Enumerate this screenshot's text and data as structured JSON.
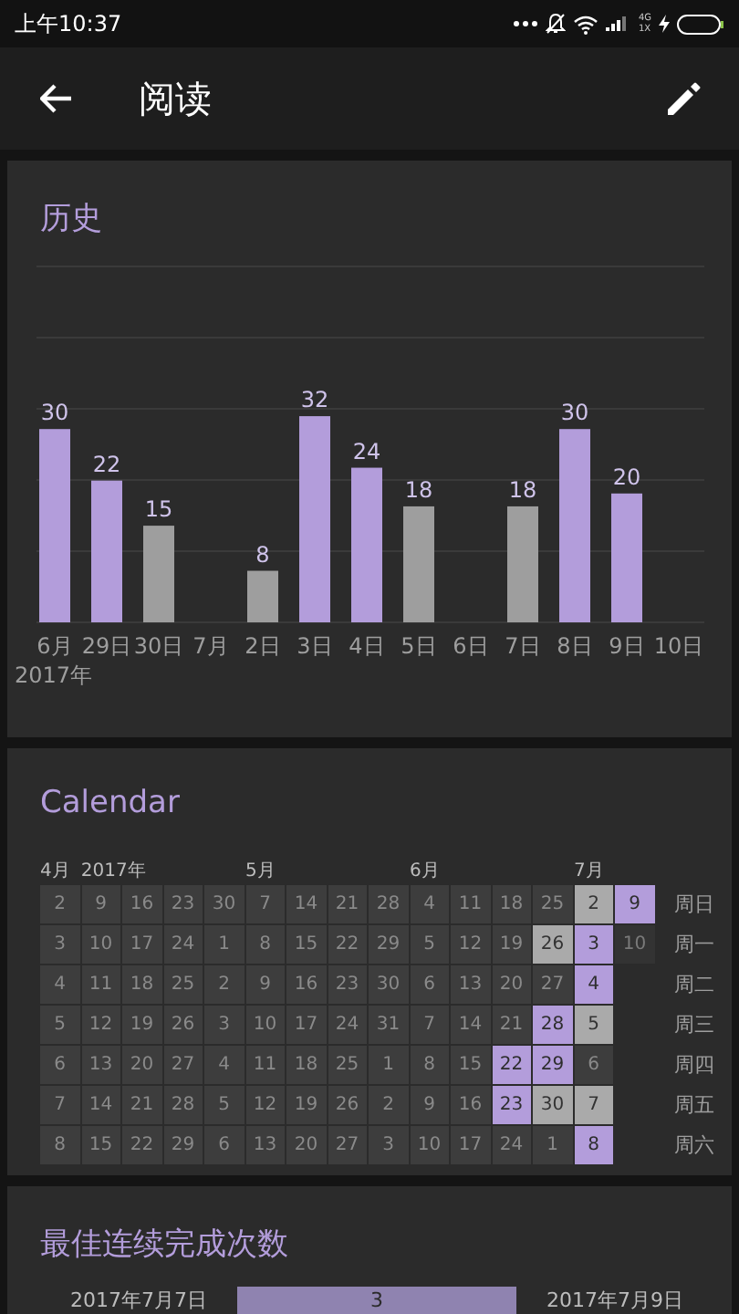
{
  "status_bar": {
    "time": "上午10:37",
    "network_top": "4G",
    "network_bottom": "1X"
  },
  "app_bar": {
    "title": "阅读"
  },
  "history": {
    "title": "历史",
    "year_label": "2017年",
    "chart_data": {
      "type": "bar",
      "stacked": true,
      "data_labels": true,
      "categories": [
        "6月",
        "29日",
        "30日",
        "7月",
        "2日",
        "3日",
        "4日",
        "5日",
        "6日",
        "7日",
        "8日",
        "9日",
        "10日"
      ],
      "series": [
        {
          "color": "#b39ddb",
          "values": [
            30,
            22,
            null,
            null,
            null,
            32,
            24,
            null,
            null,
            null,
            30,
            20,
            null
          ]
        },
        {
          "color": "#9e9e9e",
          "values": [
            null,
            null,
            15,
            null,
            8,
            null,
            null,
            18,
            null,
            18,
            null,
            null,
            null
          ]
        }
      ]
    }
  },
  "calendar": {
    "title": "Calendar",
    "weekdays": [
      "周日",
      "周一",
      "周二",
      "周三",
      "周四",
      "周五",
      "周六"
    ],
    "columns": [
      {
        "month_label": "4月",
        "year_label": "2017年",
        "days": [
          {
            "day": "2",
            "kind": "none"
          },
          {
            "day": "3",
            "kind": "none"
          },
          {
            "day": "4",
            "kind": "none"
          },
          {
            "day": "5",
            "kind": "none"
          },
          {
            "day": "6",
            "kind": "none"
          },
          {
            "day": "7",
            "kind": "none"
          },
          {
            "day": "8",
            "kind": "none"
          }
        ]
      },
      {
        "days": [
          {
            "day": "9",
            "kind": "none"
          },
          {
            "day": "10",
            "kind": "none"
          },
          {
            "day": "11",
            "kind": "none"
          },
          {
            "day": "12",
            "kind": "none"
          },
          {
            "day": "13",
            "kind": "none"
          },
          {
            "day": "14",
            "kind": "none"
          },
          {
            "day": "15",
            "kind": "none"
          }
        ]
      },
      {
        "days": [
          {
            "day": "16",
            "kind": "none"
          },
          {
            "day": "17",
            "kind": "none"
          },
          {
            "day": "18",
            "kind": "none"
          },
          {
            "day": "19",
            "kind": "none"
          },
          {
            "day": "20",
            "kind": "none"
          },
          {
            "day": "21",
            "kind": "none"
          },
          {
            "day": "22",
            "kind": "none"
          }
        ]
      },
      {
        "days": [
          {
            "day": "23",
            "kind": "none"
          },
          {
            "day": "24",
            "kind": "none"
          },
          {
            "day": "25",
            "kind": "none"
          },
          {
            "day": "26",
            "kind": "none"
          },
          {
            "day": "27",
            "kind": "none"
          },
          {
            "day": "28",
            "kind": "none"
          },
          {
            "day": "29",
            "kind": "none"
          }
        ]
      },
      {
        "days": [
          {
            "day": "30",
            "kind": "none"
          },
          {
            "day": "1",
            "kind": "none"
          },
          {
            "day": "2",
            "kind": "none"
          },
          {
            "day": "3",
            "kind": "none"
          },
          {
            "day": "4",
            "kind": "none"
          },
          {
            "day": "5",
            "kind": "none"
          },
          {
            "day": "6",
            "kind": "none"
          }
        ]
      },
      {
        "month_label": "5月",
        "days": [
          {
            "day": "7",
            "kind": "none"
          },
          {
            "day": "8",
            "kind": "none"
          },
          {
            "day": "9",
            "kind": "none"
          },
          {
            "day": "10",
            "kind": "none"
          },
          {
            "day": "11",
            "kind": "none"
          },
          {
            "day": "12",
            "kind": "none"
          },
          {
            "day": "13",
            "kind": "none"
          }
        ]
      },
      {
        "days": [
          {
            "day": "14",
            "kind": "none"
          },
          {
            "day": "15",
            "kind": "none"
          },
          {
            "day": "16",
            "kind": "none"
          },
          {
            "day": "17",
            "kind": "none"
          },
          {
            "day": "18",
            "kind": "none"
          },
          {
            "day": "19",
            "kind": "none"
          },
          {
            "day": "20",
            "kind": "none"
          }
        ]
      },
      {
        "days": [
          {
            "day": "21",
            "kind": "none"
          },
          {
            "day": "22",
            "kind": "none"
          },
          {
            "day": "23",
            "kind": "none"
          },
          {
            "day": "24",
            "kind": "none"
          },
          {
            "day": "25",
            "kind": "none"
          },
          {
            "day": "26",
            "kind": "none"
          },
          {
            "day": "27",
            "kind": "none"
          }
        ]
      },
      {
        "days": [
          {
            "day": "28",
            "kind": "none"
          },
          {
            "day": "29",
            "kind": "none"
          },
          {
            "day": "30",
            "kind": "none"
          },
          {
            "day": "31",
            "kind": "none"
          },
          {
            "day": "1",
            "kind": "none"
          },
          {
            "day": "2",
            "kind": "none"
          },
          {
            "day": "3",
            "kind": "none"
          }
        ]
      },
      {
        "month_label": "6月",
        "days": [
          {
            "day": "4",
            "kind": "none"
          },
          {
            "day": "5",
            "kind": "none"
          },
          {
            "day": "6",
            "kind": "none"
          },
          {
            "day": "7",
            "kind": "none"
          },
          {
            "day": "8",
            "kind": "none"
          },
          {
            "day": "9",
            "kind": "none"
          },
          {
            "day": "10",
            "kind": "none"
          }
        ]
      },
      {
        "days": [
          {
            "day": "11",
            "kind": "none"
          },
          {
            "day": "12",
            "kind": "none"
          },
          {
            "day": "13",
            "kind": "none"
          },
          {
            "day": "14",
            "kind": "none"
          },
          {
            "day": "15",
            "kind": "none"
          },
          {
            "day": "16",
            "kind": "none"
          },
          {
            "day": "17",
            "kind": "none"
          }
        ]
      },
      {
        "days": [
          {
            "day": "18",
            "kind": "none"
          },
          {
            "day": "19",
            "kind": "none"
          },
          {
            "day": "20",
            "kind": "none"
          },
          {
            "day": "21",
            "kind": "none"
          },
          {
            "day": "22",
            "kind": "done"
          },
          {
            "day": "23",
            "kind": "done"
          },
          {
            "day": "24",
            "kind": "none"
          }
        ]
      },
      {
        "days": [
          {
            "day": "25",
            "kind": "none"
          },
          {
            "day": "26",
            "kind": "partial"
          },
          {
            "day": "27",
            "kind": "none"
          },
          {
            "day": "28",
            "kind": "done"
          },
          {
            "day": "29",
            "kind": "done"
          },
          {
            "day": "30",
            "kind": "partial"
          },
          {
            "day": "1",
            "kind": "none"
          }
        ]
      },
      {
        "month_label": "7月",
        "days": [
          {
            "day": "2",
            "kind": "partial"
          },
          {
            "day": "3",
            "kind": "done"
          },
          {
            "day": "4",
            "kind": "done"
          },
          {
            "day": "5",
            "kind": "partial"
          },
          {
            "day": "6",
            "kind": "none"
          },
          {
            "day": "7",
            "kind": "partial"
          },
          {
            "day": "8",
            "kind": "done"
          }
        ]
      },
      {
        "days": [
          {
            "day": "9",
            "kind": "done"
          },
          {
            "day": "10",
            "kind": "future"
          }
        ]
      }
    ]
  },
  "streaks": {
    "title": "最佳连续完成次数",
    "rows": [
      {
        "start": "2017年7月7日",
        "count": "3",
        "end": "2017年7月9日"
      }
    ]
  }
}
